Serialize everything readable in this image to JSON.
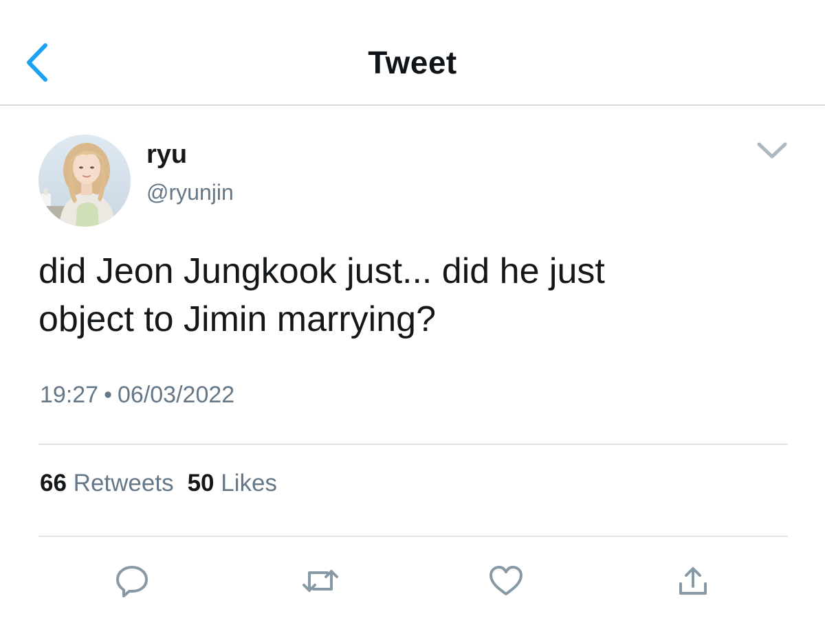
{
  "header": {
    "title": "Tweet",
    "back_icon": "chevron-left-icon",
    "accent_color": "#1da1f2"
  },
  "tweet": {
    "author_name": "ryu",
    "author_handle": "@ryunjin",
    "text": "did Jeon Jungkook just... did he just\nobject to Jimin marrying?",
    "time": "19:27",
    "separator": "•",
    "date": "06/03/2022",
    "retweets_count": "66",
    "retweets_label": "Retweets",
    "likes_count": "50",
    "likes_label": "Likes"
  },
  "actions": [
    {
      "icon": "reply-icon"
    },
    {
      "icon": "retweet-icon"
    },
    {
      "icon": "like-icon"
    },
    {
      "icon": "share-icon"
    }
  ],
  "colors": {
    "text_primary": "#14171a",
    "text_secondary": "#657786",
    "icon_gray": "#8899a6",
    "divider": "#e1e3e5"
  }
}
